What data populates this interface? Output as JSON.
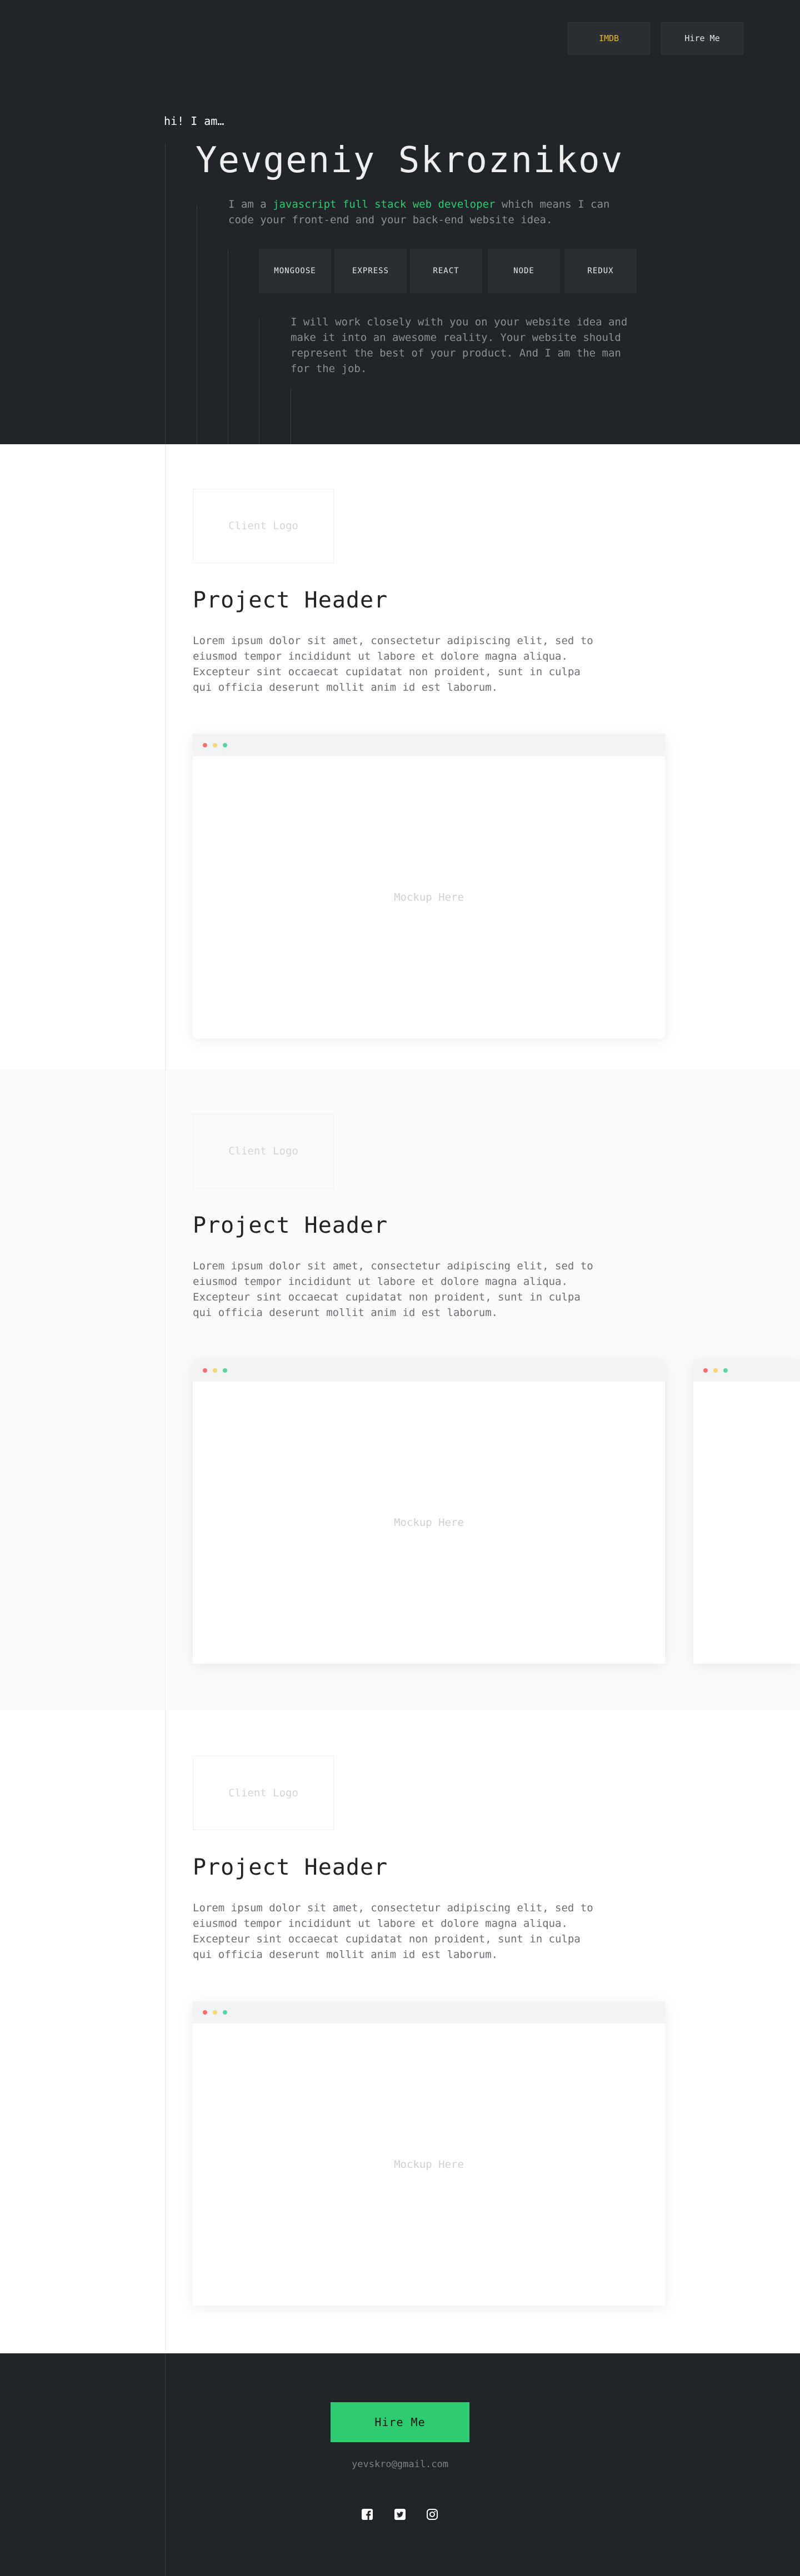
{
  "nav": {
    "imdb_label": "IMDB",
    "hire_label": "Hire Me"
  },
  "hero": {
    "greeting": "hi! I am…",
    "name": "Yevgeniy Skroznikov",
    "intro_prefix": "I am a ",
    "intro_highlight": "javascript full stack web developer",
    "intro_suffix": " which means I can code your front-end and your back-end website idea.",
    "stack": [
      "MONGOOSE",
      "EXPRESS",
      "REACT",
      "NODE",
      "REDUX"
    ],
    "promise": "I will work closely with you on your website idea and make it into an awesome reality. Your website should represent the best of your product. And I am the man for the job."
  },
  "projects": [
    {
      "logo": "Client Logo",
      "header": "Project Header",
      "body": "Lorem ipsum dolor sit amet, consectetur adipiscing elit, sed to eiusmod tempor incididunt ut labore et dolore magna aliqua. Excepteur sint occaecat cupidatat non proident, sunt in culpa qui officia deserunt mollit anim id est laborum.",
      "mockup": "Mockup Here"
    },
    {
      "logo": "Client Logo",
      "header": "Project Header",
      "body": "Lorem ipsum dolor sit amet, consectetur adipiscing elit, sed to eiusmod tempor incididunt ut labore et dolore magna aliqua. Excepteur sint occaecat cupidatat non proident, sunt in culpa qui officia deserunt mollit anim id est laborum.",
      "mockup": "Mockup Here"
    },
    {
      "logo": "Client Logo",
      "header": "Project Header",
      "body": "Lorem ipsum dolor sit amet, consectetur adipiscing elit, sed to eiusmod tempor incididunt ut labore et dolore magna aliqua. Excepteur sint occaecat cupidatat non proident, sunt in culpa qui officia deserunt mollit anim id est laborum.",
      "mockup": "Mockup Here"
    }
  ],
  "footer": {
    "hire_label": "Hire Me",
    "email": "yevskro@gmail.com",
    "social_icons": [
      "facebook-icon",
      "twitter-icon",
      "instagram-icon"
    ]
  },
  "colors": {
    "dark_bg": "#212428",
    "accent_green": "#2ecc71",
    "imdb_yellow": "#e6b91e"
  }
}
